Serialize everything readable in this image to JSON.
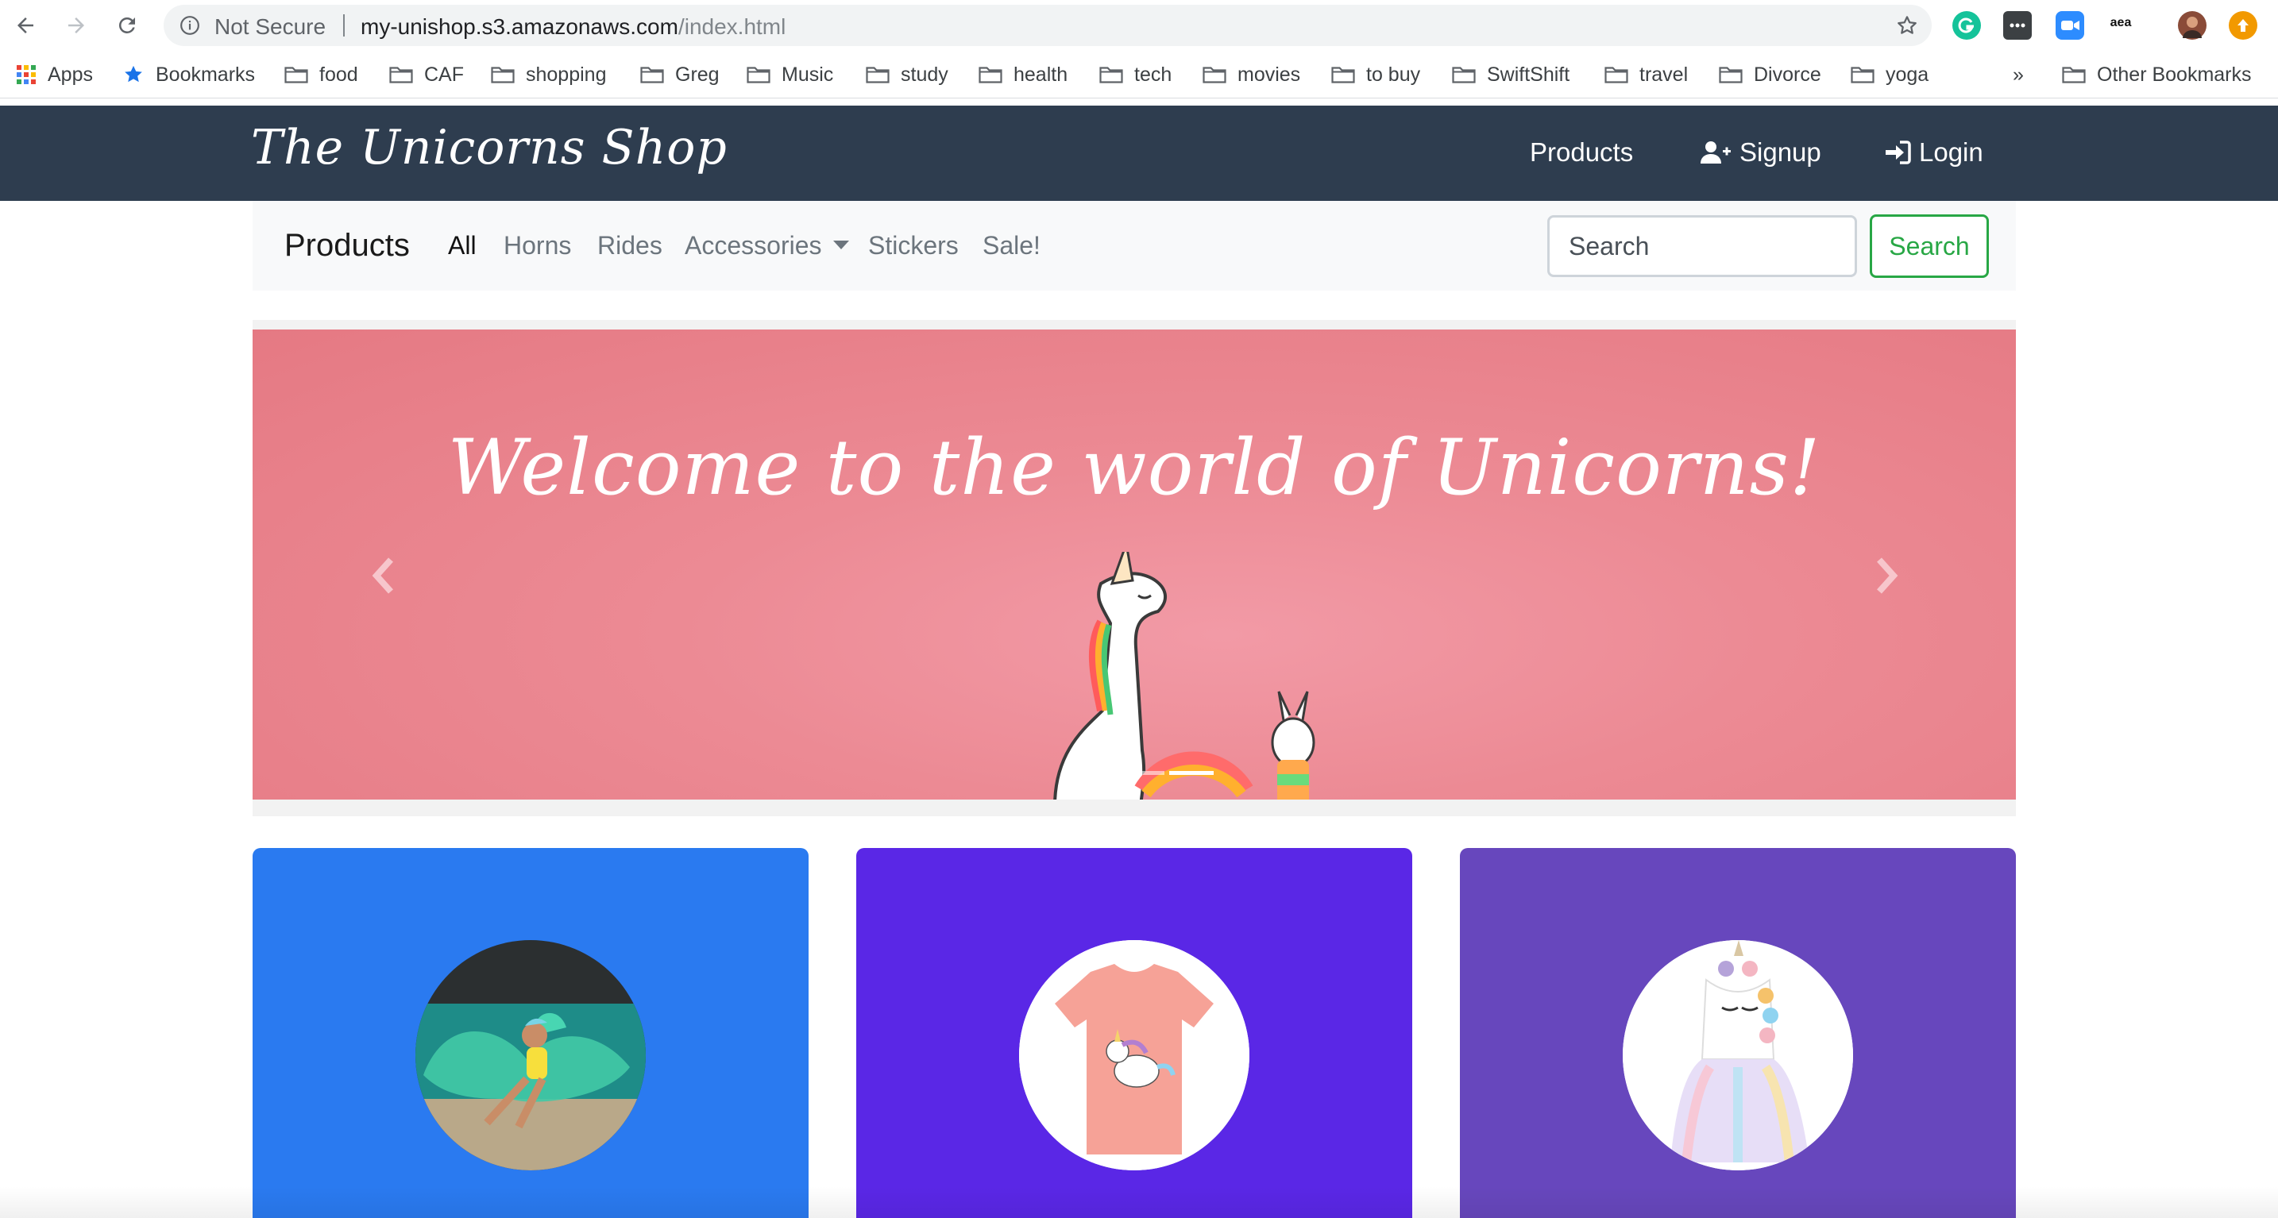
{
  "browser": {
    "security_label": "Not Secure",
    "url_host": "my-unishop.s3.amazonaws.com",
    "url_path": "/index.html",
    "ext_label": "aea",
    "bookmarks": [
      {
        "label": "Apps",
        "icon": "apps-grid-icon"
      },
      {
        "label": "Bookmarks",
        "icon": "star-icon"
      },
      {
        "label": "food",
        "icon": "folder-icon"
      },
      {
        "label": "CAF",
        "icon": "folder-icon"
      },
      {
        "label": "shopping",
        "icon": "folder-icon"
      },
      {
        "label": "Greg",
        "icon": "folder-icon"
      },
      {
        "label": "Music",
        "icon": "folder-icon"
      },
      {
        "label": "study",
        "icon": "folder-icon"
      },
      {
        "label": "health",
        "icon": "folder-icon"
      },
      {
        "label": "tech",
        "icon": "folder-icon"
      },
      {
        "label": "movies",
        "icon": "folder-icon"
      },
      {
        "label": "to buy",
        "icon": "folder-icon"
      },
      {
        "label": "SwiftShift",
        "icon": "folder-icon"
      },
      {
        "label": "travel",
        "icon": "folder-icon"
      },
      {
        "label": "Divorce",
        "icon": "folder-icon"
      },
      {
        "label": "yoga",
        "icon": "folder-icon"
      }
    ],
    "overflow_label": "»",
    "other_bookmarks": "Other Bookmarks"
  },
  "site": {
    "logo": "The Unicorns Shop",
    "header_links": {
      "products": "Products",
      "signup": "Signup",
      "login": "Login"
    },
    "colors": {
      "header_bg": "#2e3d4f",
      "accent_green": "#28a745"
    }
  },
  "product_nav": {
    "brand": "Products",
    "links": [
      "All",
      "Horns",
      "Rides",
      "Accessories",
      "Stickers",
      "Sale!"
    ],
    "active": "All",
    "search_placeholder": "Search",
    "search_button": "Search"
  },
  "carousel": {
    "caption": "Welcome to the world of Unicorns!",
    "background": "#e97a85"
  },
  "cards": [
    {
      "bg": "#2a7af0",
      "image": "unicorn-pool-float-image"
    },
    {
      "bg": "#5a27e6",
      "image": "unicorn-tshirt-image"
    },
    {
      "bg": "#6747bd",
      "image": "unicorn-tutu-dress-image"
    }
  ]
}
